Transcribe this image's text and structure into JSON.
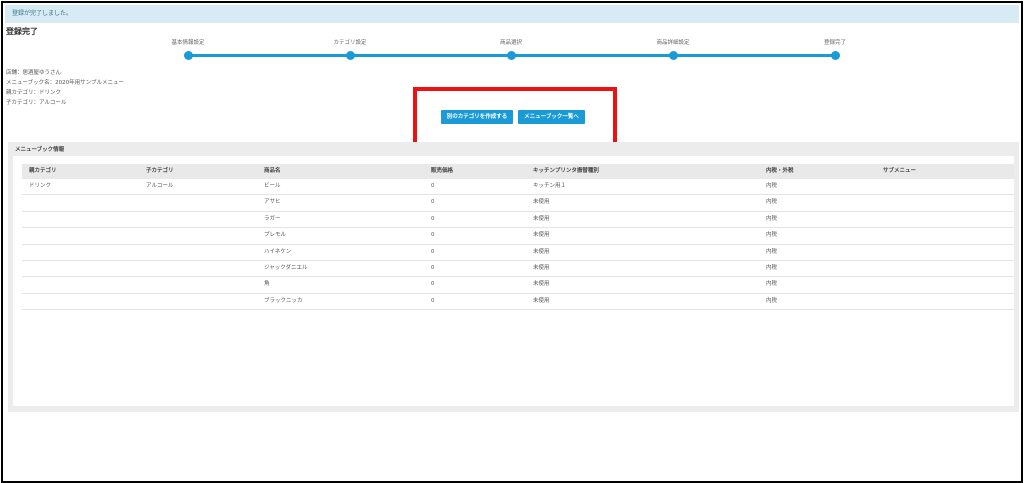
{
  "alert": "登録が完了しました。",
  "page_title": "登録完了",
  "stepper": [
    "基本情報設定",
    "カテゴリ設定",
    "商品選択",
    "商品詳細設定",
    "登録完了"
  ],
  "info": {
    "store": "店舗：居酒屋ゆうさん",
    "menubook": "メニューブック名：2020年用サンプルメニュー",
    "parent_category": "親カテゴリ：ドリンク",
    "child_category": "子カテゴリ：アルコール"
  },
  "buttons": {
    "create_category": "別のカテゴリを作成する",
    "to_menubook_list": "メニューブック一覧へ"
  },
  "panel_title": "メニューブック情報",
  "table": {
    "headers": [
      "親カテゴリ",
      "子カテゴリ",
      "商品名",
      "販売価格",
      "キッチンプリンタ振替種別",
      "内税・外税",
      "サブメニュー"
    ],
    "rows": [
      [
        "ドリンク",
        "アルコール",
        "ビール",
        "0",
        "キッチン用１",
        "内税",
        ""
      ],
      [
        "",
        "",
        "アサヒ",
        "0",
        "未使用",
        "内税",
        ""
      ],
      [
        "",
        "",
        "ラガー",
        "0",
        "未使用",
        "内税",
        ""
      ],
      [
        "",
        "",
        "プレモル",
        "0",
        "未使用",
        "内税",
        ""
      ],
      [
        "",
        "",
        "ハイネケン",
        "0",
        "未使用",
        "内税",
        ""
      ],
      [
        "",
        "",
        "ジャックダニエル",
        "0",
        "未使用",
        "内税",
        ""
      ],
      [
        "",
        "",
        "角",
        "0",
        "未使用",
        "内税",
        ""
      ],
      [
        "",
        "",
        "ブラックニッカ",
        "0",
        "未使用",
        "内税",
        ""
      ]
    ]
  }
}
